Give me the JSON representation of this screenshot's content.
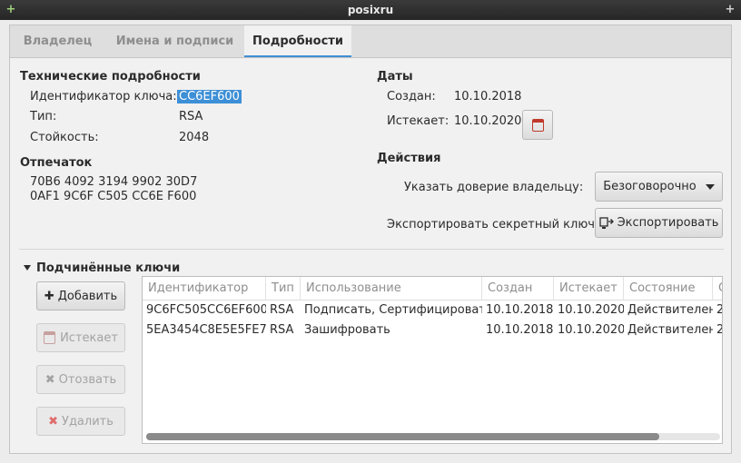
{
  "window": {
    "title": "posixru",
    "left_button": "+",
    "right_button": "+"
  },
  "tabs": [
    {
      "label": "Владелец"
    },
    {
      "label": "Имена и подписи"
    },
    {
      "label": "Подробности"
    }
  ],
  "tech": {
    "heading": "Технические подробности",
    "key_id_label": "Идентификатор ключа:",
    "key_id_value": "CC6EF600",
    "type_label": "Тип:",
    "type_value": "RSA",
    "strength_label": "Стойкость:",
    "strength_value": "2048"
  },
  "fingerprint": {
    "heading": "Отпечаток",
    "line1": "70B6 4092 3194 9902 30D7",
    "line2": "0AF1 9C6F C505 CC6E F600"
  },
  "dates": {
    "heading": "Даты",
    "created_label": "Создан:",
    "created_value": "10.10.2018",
    "expires_label": "Истекает:",
    "expires_value": "10.10.2020"
  },
  "actions": {
    "heading": "Действия",
    "trust_label": "Указать доверие владельцу:",
    "trust_value": "Безоговорочно",
    "export_label": "Экспортировать секретный ключ:",
    "export_button": "Экспортировать"
  },
  "subkeys": {
    "heading": "Подчинённые ключи",
    "buttons": {
      "add": "Добавить",
      "expire": "Истекает",
      "revoke": "Отозвать",
      "delete": "Удалить"
    },
    "columns": [
      "Идентификатор",
      "Тип",
      "Использование",
      "Создан",
      "Истекает",
      "Состояние",
      "С"
    ],
    "rows": [
      [
        "9C6FC505CC6EF600",
        "RSA",
        "Подписать, Сертифицировать",
        "10.10.2018",
        "10.10.2020",
        "Действителен",
        "2"
      ],
      [
        "5EA3454C8E5E5FE7",
        "RSA",
        "Зашифровать",
        "10.10.2018",
        "10.10.2020",
        "Действителен",
        "2"
      ]
    ]
  },
  "colors": {
    "accent": "#3d8fd6",
    "calendar_red": "#c0392b"
  }
}
